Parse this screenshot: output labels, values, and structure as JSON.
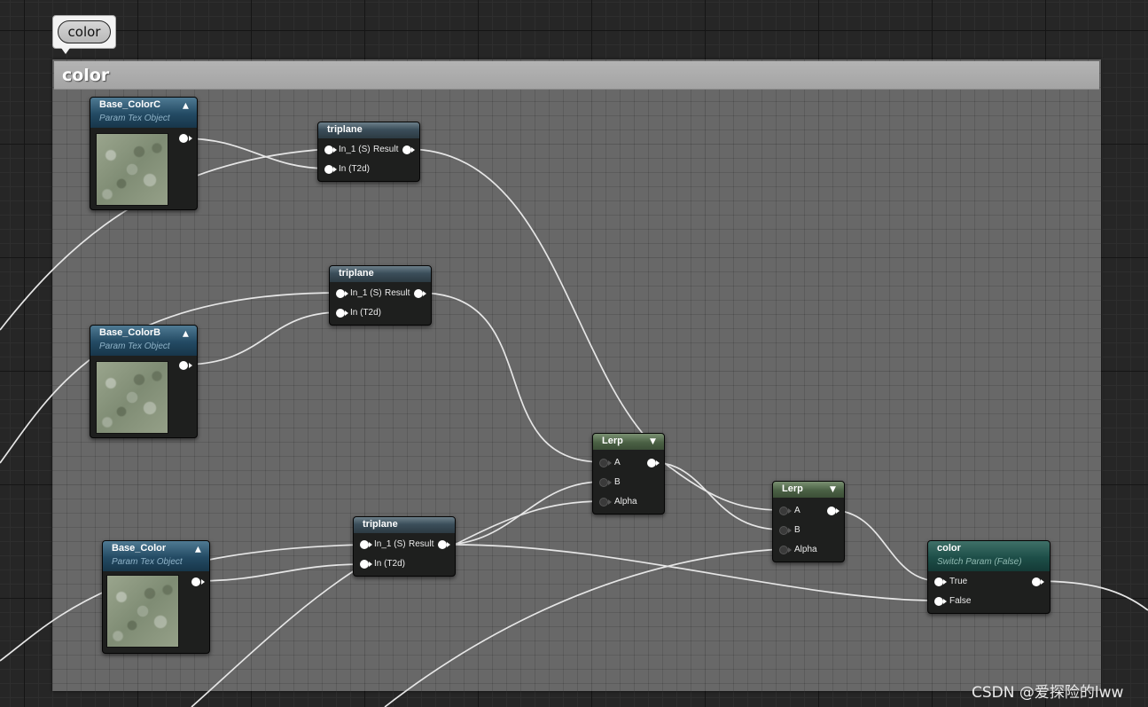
{
  "comment": {
    "bubble_label": "color",
    "title": "color"
  },
  "nodes": {
    "base_colorc": {
      "title": "Base_ColorC",
      "subtitle": "Param Tex Object"
    },
    "base_colorb": {
      "title": "Base_ColorB",
      "subtitle": "Param Tex Object"
    },
    "base_color": {
      "title": "Base_Color",
      "subtitle": "Param Tex Object"
    },
    "triplane_1": {
      "title": "triplane",
      "in1": "In_1 (S)",
      "out": "Result",
      "in2": "In (T2d)"
    },
    "triplane_2": {
      "title": "triplane",
      "in1": "In_1 (S)",
      "out": "Result",
      "in2": "In (T2d)"
    },
    "triplane_3": {
      "title": "triplane",
      "in1": "In_1 (S)",
      "out": "Result",
      "in2": "In (T2d)"
    },
    "lerp_1": {
      "title": "Lerp",
      "a": "A",
      "b": "B",
      "alpha": "Alpha"
    },
    "lerp_2": {
      "title": "Lerp",
      "a": "A",
      "b": "B",
      "alpha": "Alpha"
    },
    "switch": {
      "title": "color",
      "subtitle": "Switch Param (False)",
      "true": "True",
      "false": "False"
    }
  },
  "watermark": "CSDN @爱探险的lww",
  "icons": {
    "collapse": "chevron-up-icon",
    "expand": "chevron-down-icon",
    "pin": "pin-circle-icon"
  },
  "colors": {
    "graph_background": "#262626",
    "comment_body": "#787878",
    "comment_header": "#a8a8a8",
    "wire": "#e6e6e6",
    "texture_node_header": "#234a63",
    "function_node_header": "#3b4e5a",
    "lerp_node_header": "#4a6044",
    "switch_node_header": "#1d4e48"
  }
}
